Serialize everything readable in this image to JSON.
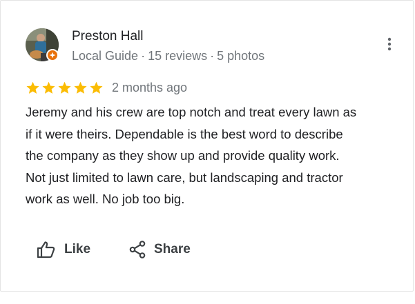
{
  "reviewer": {
    "name": "Preston Hall",
    "badge": "Local Guide",
    "separator": "·",
    "reviews": "15 reviews",
    "photos": "5 photos",
    "badge_color": "#e8710a"
  },
  "rating": {
    "stars": 5,
    "star_color": "#fbbc04",
    "date": "2 months ago"
  },
  "review": {
    "lines": [
      "Jeremy and his crew are top notch and treat every lawn as",
      "if it were theirs. Dependable is the best word to describe",
      "the company as they show up and provide quality work.",
      "Not just limited to lawn care, but landscaping and tractor",
      "work as well. No job too big."
    ]
  },
  "actions": {
    "like": {
      "label": "Like",
      "icon": "thumbs-up-icon"
    },
    "share": {
      "label": "Share",
      "icon": "share-icon"
    },
    "more": {
      "icon": "more-vert-icon"
    }
  }
}
